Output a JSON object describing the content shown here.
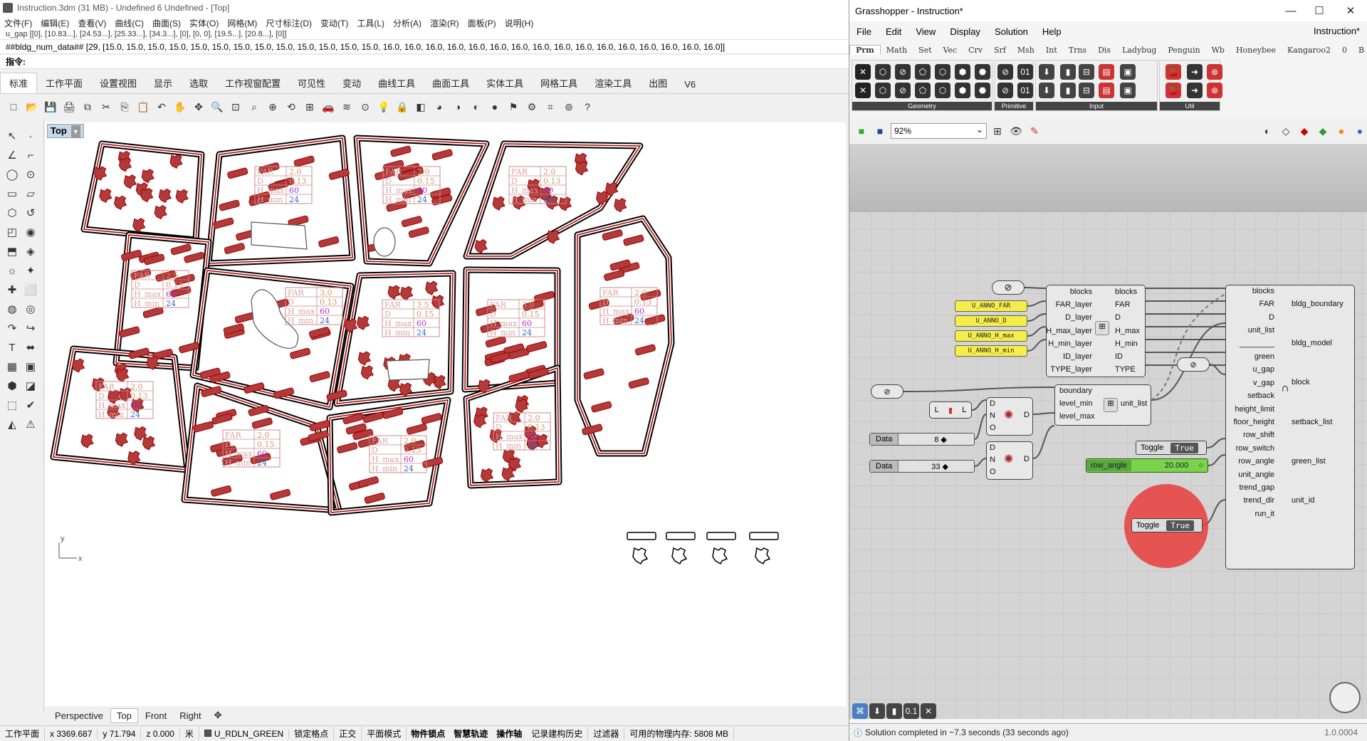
{
  "rhino": {
    "title": "Instruction.3dm (31 MB) - Undefined 6 Undefined - [Top]",
    "menu": [
      "文件(F)",
      "编辑(E)",
      "查看(V)",
      "曲线(C)",
      "曲面(S)",
      "实体(O)",
      "网格(M)",
      "尺寸标注(D)",
      "变动(T)",
      "工具(L)",
      "分析(A)",
      "渲染(R)",
      "面板(P)",
      "说明(H)"
    ],
    "history_line": "u_gap [[0], [10.83...], [24.53...], [25.33...], [34.3...], [0], [0, 0], [19.5...], [20.8...], [0]]",
    "data_line": "##bldg_num_data## [29, [15.0, 15.0, 15.0, 15.0, 15.0, 15.0, 15.0, 15.0, 15.0, 15.0, 15.0, 15.0, 15.0, 16.0, 16.0, 16.0, 16.0, 16.0, 16.0, 16.0, 16.0, 16.0, 16.0, 16.0, 16.0, 16.0, 16.0, 16.0, 16.0]]",
    "command_prompt": "指令:",
    "ribbon_tabs": [
      "标准",
      "工作平面",
      "设置视图",
      "显示",
      "选取",
      "工作视窗配置",
      "可见性",
      "变动",
      "曲线工具",
      "曲面工具",
      "实体工具",
      "网格工具",
      "渲染工具",
      "出图",
      "V6"
    ],
    "active_ribbon_tab": "标准",
    "viewport_name": "Top",
    "axis_y": "y",
    "axis_x": "x",
    "view_tabs": [
      "Perspective",
      "Top",
      "Front",
      "Right"
    ],
    "active_view_tab": "Top",
    "status": {
      "cplane": "工作平面",
      "x": "x 3369.687",
      "y": "y 71.794",
      "z": "z 0.000",
      "units": "米",
      "layer": "U_RDLN_GREEN",
      "toggles": [
        "锁定格点",
        "正交",
        "平面模式",
        "物件锁点",
        "智慧轨迹",
        "操作轴",
        "记录建构历史",
        "过滤器"
      ],
      "bold_toggles": [
        "物件锁点",
        "智慧轨迹",
        "操作轴"
      ],
      "memory": "可用的物理内存: 5808 MB"
    },
    "annotations": [
      {
        "lines": [
          "FAR",
          "D",
          "H_max",
          "H_min"
        ],
        "vals": [
          "2.0",
          "0.13",
          "60",
          "24"
        ]
      },
      {
        "lines": [
          "FAR",
          "D",
          "H_max",
          "H_min"
        ],
        "vals": [
          "2.0",
          "0.15",
          "60",
          "24"
        ]
      },
      {
        "lines": [
          "FAR",
          "D",
          "H_max",
          "H_min"
        ],
        "vals": [
          "2.0",
          "0.13",
          "60",
          "24"
        ]
      },
      {
        "lines": [
          "FAR",
          "D",
          "H_max",
          "H_min"
        ],
        "vals": [
          "2.5",
          "0.13",
          "60",
          "24"
        ]
      },
      {
        "lines": [
          "FAR",
          "D",
          "H_max",
          "H_min"
        ],
        "vals": [
          "3.0",
          "0.13",
          "60",
          "24"
        ]
      },
      {
        "lines": [
          "FAR",
          "D",
          "H_max",
          "H_min"
        ],
        "vals": [
          "3.5",
          "0.15",
          "60",
          "24"
        ]
      },
      {
        "lines": [
          "FAR",
          "D",
          "H_max",
          "H_min"
        ],
        "vals": [
          "3.0",
          "0.15",
          "60",
          "24"
        ]
      },
      {
        "lines": [
          "FAR",
          "D",
          "H_max",
          "H_min"
        ],
        "vals": [
          "2.0",
          "0.13",
          "60",
          "24"
        ]
      },
      {
        "lines": [
          "FAR",
          "D",
          "H_max",
          "H_min"
        ],
        "vals": [
          "2.0",
          "0.13",
          "60",
          "24"
        ]
      },
      {
        "lines": [
          "FAR",
          "D",
          "H_max",
          "H_min"
        ],
        "vals": [
          "2.0",
          "0.15",
          "60",
          "24"
        ]
      },
      {
        "lines": [
          "FAR",
          "D",
          "H_max",
          "H_min"
        ],
        "vals": [
          "2.0",
          "0.13",
          "60",
          "24"
        ]
      },
      {
        "lines": [
          "FAR",
          "D",
          "H_max",
          "H_min"
        ],
        "vals": [
          "2.0",
          "0.13",
          "60",
          "24"
        ]
      }
    ]
  },
  "grasshopper": {
    "title": "Grasshopper - Instruction*",
    "menu": [
      "File",
      "Edit",
      "View",
      "Display",
      "Solution",
      "Help"
    ],
    "doc_name": "Instruction*",
    "tabs": [
      "Prm",
      "Math",
      "Set",
      "Vec",
      "Crv",
      "Srf",
      "Msh",
      "Int",
      "Trns",
      "Dis",
      "Ladybug",
      "Penguin",
      "Wb",
      "Honeybee",
      "Kangaroo2",
      "0",
      "B"
    ],
    "active_tab": "Prm",
    "ribbon_groups": [
      "Geometry",
      "Primitive",
      "Input",
      "Util"
    ],
    "zoom": "92%",
    "panels": [
      "U_ANNO_FAR",
      "U_ANNO_D",
      "U_ANNO_H_max",
      "U_ANNO_H_min"
    ],
    "layer_comp": {
      "inputs": [
        "blocks",
        "FAR_layer",
        "D_layer",
        "H_max_layer",
        "H_min_layer",
        "ID_layer",
        "TYPE_layer"
      ],
      "outputs": [
        "blocks",
        "FAR",
        "D",
        "H_max",
        "H_min",
        "ID",
        "TYPE"
      ]
    },
    "unit_comp": {
      "inputs": [
        "boundary",
        "level_min",
        "level_max"
      ],
      "output": "unit_list"
    },
    "main_comp": {
      "inputs": [
        "blocks",
        "FAR",
        "D",
        "unit_list",
        "________",
        "green",
        "u_gap",
        "v_gap",
        "setback",
        "height_limit",
        "floor_height",
        "row_shift",
        "row_switch",
        "row_angle",
        "unit_angle",
        "trend_gap",
        "trend_dir",
        "run_it"
      ],
      "outputs": [
        "bldg_boundary",
        "bldg_model",
        "block",
        "setback_list",
        "green_list",
        "unit_id"
      ]
    },
    "lnode_label": "L",
    "dno_ports": [
      "D",
      "N",
      "O"
    ],
    "dno_out": "D",
    "data1": {
      "tag": "Data",
      "value": "8"
    },
    "data2": {
      "tag": "Data",
      "value": "33"
    },
    "toggle1": {
      "label": "Toggle",
      "value": "True"
    },
    "toggle2": {
      "label": "Toggle",
      "value": "True"
    },
    "slider": {
      "label": "row_angle",
      "value": "20.000"
    },
    "status": "Solution completed in ~7.3 seconds (33 seconds ago)",
    "version": "1.0.0004"
  },
  "colors": {
    "gh_panel": "#f5ee4a",
    "slider": "#7ad34a",
    "block_fill": "#b33a3a",
    "block_outline": "#a00000"
  }
}
